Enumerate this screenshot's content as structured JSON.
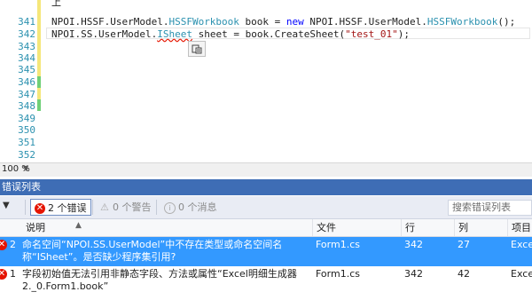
{
  "editor": {
    "top_fragment": "上",
    "line_numbers": [
      "341",
      "342",
      "343",
      "344",
      "345",
      "346",
      "347",
      "348",
      "349",
      "350",
      "351",
      "352"
    ],
    "code": {
      "line341": [
        "NPOI.HSSF.UserModel.",
        "HSSFWorkbook",
        " book = ",
        "new",
        " NPOI.HSSF.UserModel.",
        "HSSFWorkbook",
        "();"
      ],
      "line342": [
        "NPOI.SS.UserModel.",
        "ISheet",
        " sheet = book.CreateSheet(",
        "\"test_01\"",
        ");"
      ]
    },
    "smart_tag_icon": "smart-tag-icon",
    "zoom": "100 %"
  },
  "error_list": {
    "title": "错误列表",
    "toolbar": {
      "filter_icon": "▼",
      "errors": "2 个错误",
      "warnings": "0 个警告",
      "messages": "0 个消息",
      "search_placeholder": "搜索错误列表"
    },
    "columns": [
      "说明",
      "文件",
      "行",
      "列",
      "项目"
    ],
    "rows": [
      {
        "index": "2",
        "description_line1": "命名空间“NPOI.SS.UserModel”中不存在类型或命名空间名",
        "description_line2": "称“ISheet”。是否缺少程序集引用?",
        "file": "Form1.cs",
        "line": "342",
        "column": "27",
        "project": "Excel"
      },
      {
        "index": "1",
        "description_line1": "字段初始值无法引用非静态字段、方法或属性“Excel明细生成器",
        "description_line2": "2._0.Form1.book”",
        "file": "Form1.cs",
        "line": "342",
        "column": "42",
        "project": "Excel"
      }
    ]
  },
  "colors": {
    "line_number": "#2b91af",
    "type_name": "#2b91af",
    "keyword": "#0000ff",
    "string": "#a31515",
    "selection": "#3399ff",
    "error_red": "#e51400",
    "panel_title_bg": "#3e6db5"
  }
}
